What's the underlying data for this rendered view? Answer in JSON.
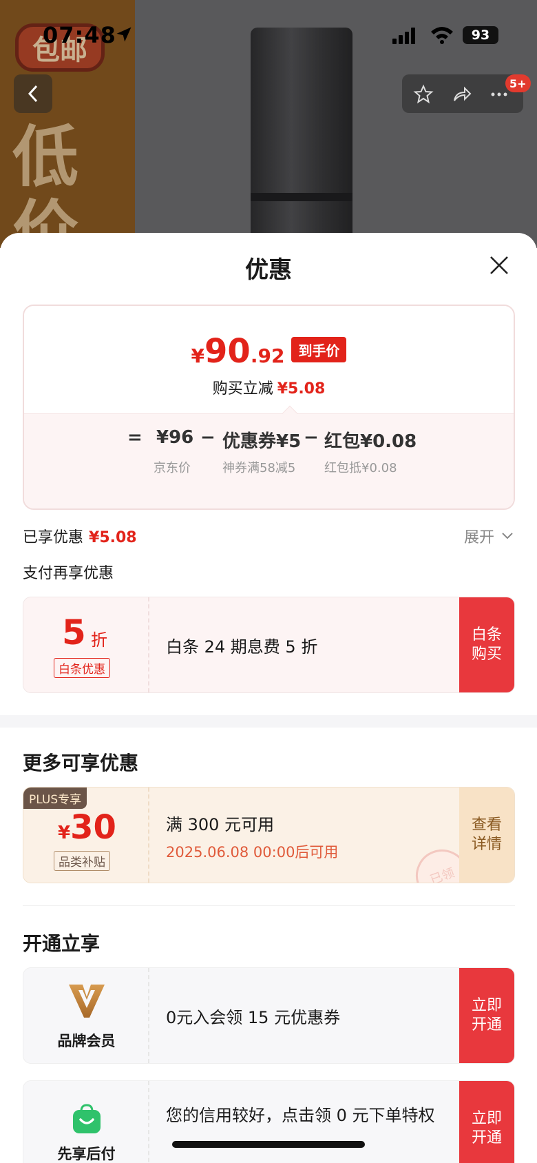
{
  "status_bar": {
    "time": "07:48",
    "battery": "93"
  },
  "background": {
    "badge": "包邮",
    "big_text_1": "低",
    "big_text_2": "价",
    "nav_badge": "5+"
  },
  "sheet": {
    "title": "优惠"
  },
  "price": {
    "currency": "¥",
    "integer": "90",
    "decimal": ".92",
    "tag": "到手价",
    "reduce_label": "购买立减",
    "reduce_value": "¥5.08"
  },
  "formula": {
    "eq": "=",
    "base": "¥96",
    "minus1": "−",
    "coupon": "优惠券¥5",
    "minus2": "−",
    "redpacket": "红包¥0.08",
    "base_sub": "京东价",
    "coupon_sub": "神券满58减5",
    "redpacket_sub": "红包抵¥0.08"
  },
  "enjoyed": {
    "label": "已享优惠",
    "value": "¥5.08",
    "expand": "展开"
  },
  "pay_more": {
    "title": "支付再享优惠"
  },
  "baitiao": {
    "discount": "5",
    "discount_unit": "折",
    "tag": "白条优惠",
    "text": "白条 24 期息费 5 折",
    "action": "白条购买"
  },
  "more": {
    "title": "更多可享优惠"
  },
  "plus_coupon": {
    "tag": "PLUS专享",
    "currency": "¥",
    "amount": "30",
    "sub": "品类补贴",
    "line1": "满 300 元可用",
    "line2": "2025.06.08 00:00后可用",
    "stamp": "已领",
    "action": "查看详情"
  },
  "open": {
    "title": "开通立享"
  },
  "brand_member": {
    "name": "品牌会员",
    "text": "0元入会领 15 元优惠券",
    "action": "立即开通"
  },
  "xianxiang": {
    "name": "先享后付",
    "text": "您的信用较好，点击领 0 元下单特权",
    "action": "立即开通"
  }
}
